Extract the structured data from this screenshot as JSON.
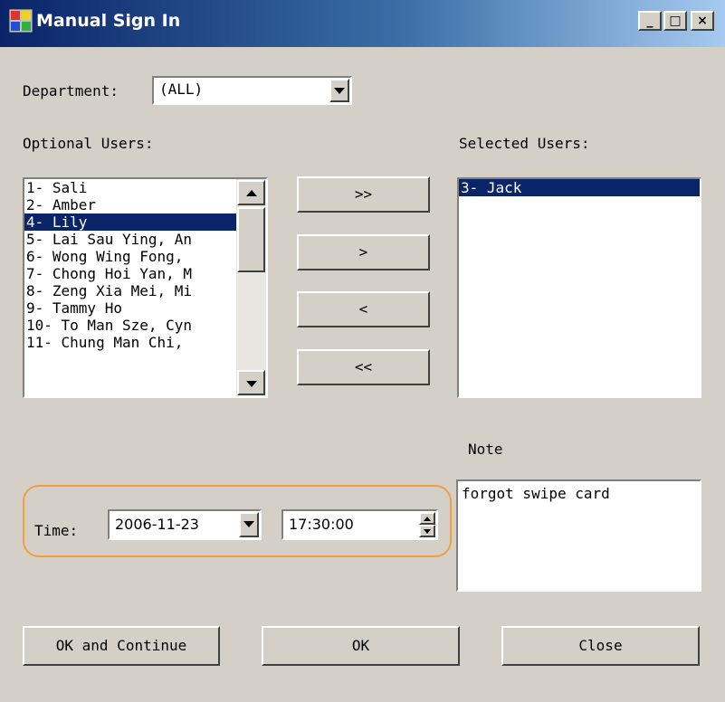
{
  "window": {
    "title": "Manual Sign In",
    "minimize_glyph": "_",
    "maximize_glyph": "□",
    "close_glyph": "×"
  },
  "department": {
    "label": "Department:",
    "value": "(ALL)"
  },
  "optional_users": {
    "label": "Optional Users:",
    "items": [
      "1- Sali",
      "2- Amber",
      "4- Lily",
      "5- Lai Sau Ying, An",
      "6- Wong Wing Fong,",
      "7- Chong Hoi Yan, M",
      "8- Zeng Xia Mei, Mi",
      "9- Tammy Ho",
      "10- To Man Sze, Cyn",
      "11- Chung Man Chi,"
    ],
    "selected_index": 2
  },
  "selected_users": {
    "label": "Selected Users:",
    "items": [
      "3- Jack"
    ],
    "selected_index": 0
  },
  "transfer_buttons": {
    "add_all": ">>",
    "add": ">",
    "remove": "<",
    "remove_all": "<<"
  },
  "note": {
    "label": "Note",
    "value": "forgot swipe card"
  },
  "time": {
    "label": "Time:",
    "date": "2006-11-23",
    "clock": "17:30:00"
  },
  "buttons": {
    "ok_continue": "OK and Continue",
    "ok": "OK",
    "close": "Close"
  },
  "colors": {
    "face": "#d4d0c8",
    "selection": "#0a246a",
    "highlight_outline": "#f0a040"
  }
}
